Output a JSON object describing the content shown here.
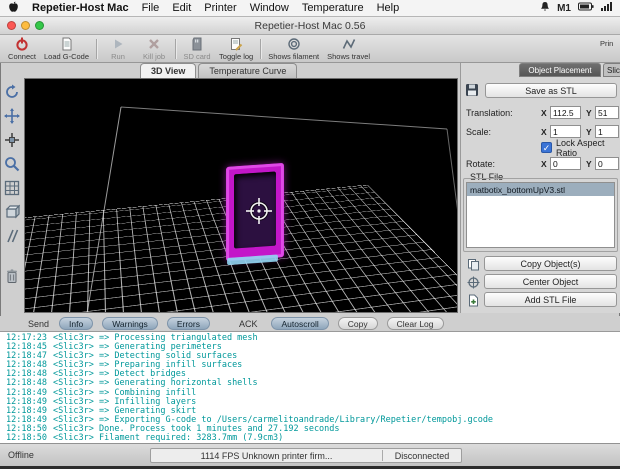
{
  "menubar": {
    "items": [
      "Repetier-Host Mac",
      "File",
      "Edit",
      "Printer",
      "Window",
      "Temperature",
      "Help"
    ],
    "status_text": "M1"
  },
  "titlebar": {
    "title": "Repetier-Host Mac 0.56"
  },
  "toolbar": {
    "connect": "Connect",
    "load_gcode": "Load G-Code",
    "run": "Run",
    "kill_job": "Kill job",
    "sd_card": "SD card",
    "toggle_log": "Toggle log",
    "shows_filament": "Shows filament",
    "shows_travel": "Shows travel",
    "right_partial": "Prin"
  },
  "view_tabs": {
    "three_d": "3D View",
    "temp_curve": "Temperature Curve"
  },
  "side_panel": {
    "tab_object_placement": "Object Placement",
    "tab_slice": "Slice",
    "save_stl": "Save as STL",
    "translation": {
      "label": "Translation:",
      "x_label": "X",
      "x": "112.5",
      "y_label": "Y",
      "y": "51"
    },
    "scale": {
      "label": "Scale:",
      "x_label": "X",
      "x": "1",
      "y_label": "Y",
      "y": "1"
    },
    "lock_aspect": "Lock Aspect Ratio",
    "rotate": {
      "label": "Rotate:",
      "x_label": "X",
      "x": "0",
      "y_label": "Y",
      "y": "0"
    },
    "stl_group": "STL File",
    "stl_files": [
      {
        "name": "matbotix_bottomUpV3.stl",
        "selected": true
      }
    ],
    "copy_object": "Copy Object(s)",
    "center_object": "Center Object",
    "add_stl": "Add STL File"
  },
  "log_toolbar": {
    "send": "Send",
    "info": "Info",
    "warnings": "Warnings",
    "errors": "Errors",
    "ack": "ACK",
    "autoscroll": "Autoscroll",
    "copy": "Copy",
    "clear": "Clear Log"
  },
  "log": {
    "lines": [
      {
        "time": "12:17:23",
        "text": "<Slic3r> => Processing triangulated mesh"
      },
      {
        "time": "12:18:45",
        "text": "<Slic3r> => Generating perimeters"
      },
      {
        "time": "12:18:47",
        "text": "<Slic3r> => Detecting solid surfaces"
      },
      {
        "time": "12:18:48",
        "text": "<Slic3r> => Preparing infill surfaces"
      },
      {
        "time": "12:18:48",
        "text": "<Slic3r> => Detect bridges"
      },
      {
        "time": "12:18:48",
        "text": "<Slic3r> => Generating horizontal shells"
      },
      {
        "time": "12:18:49",
        "text": "<Slic3r> => Combining infill"
      },
      {
        "time": "12:18:49",
        "text": "<Slic3r> => Infilling layers"
      },
      {
        "time": "12:18:49",
        "text": "<Slic3r> => Generating skirt"
      },
      {
        "time": "12:18:49",
        "text": "<Slic3r> => Exporting G-code to /Users/carmelitoandrade/Library/Repetier/tempobj.gcode"
      },
      {
        "time": "12:18:50",
        "text": "<Slic3r> Done. Process took 1 minutes and 27.192 seconds"
      },
      {
        "time": "12:18:50",
        "text": "<Slic3r> Filament required: 3283.7mm (7.9cm3)"
      }
    ]
  },
  "statusbar": {
    "offline": "Offline",
    "fps": "1114 FPS Unknown printer firm...",
    "connection": "Disconnected"
  },
  "colors": {
    "accent_teal_log": "#00989a",
    "object_magenta": "#c316c9",
    "selection_gray_blue": "#9caebd",
    "pill_blue": "#8fa6bb"
  }
}
